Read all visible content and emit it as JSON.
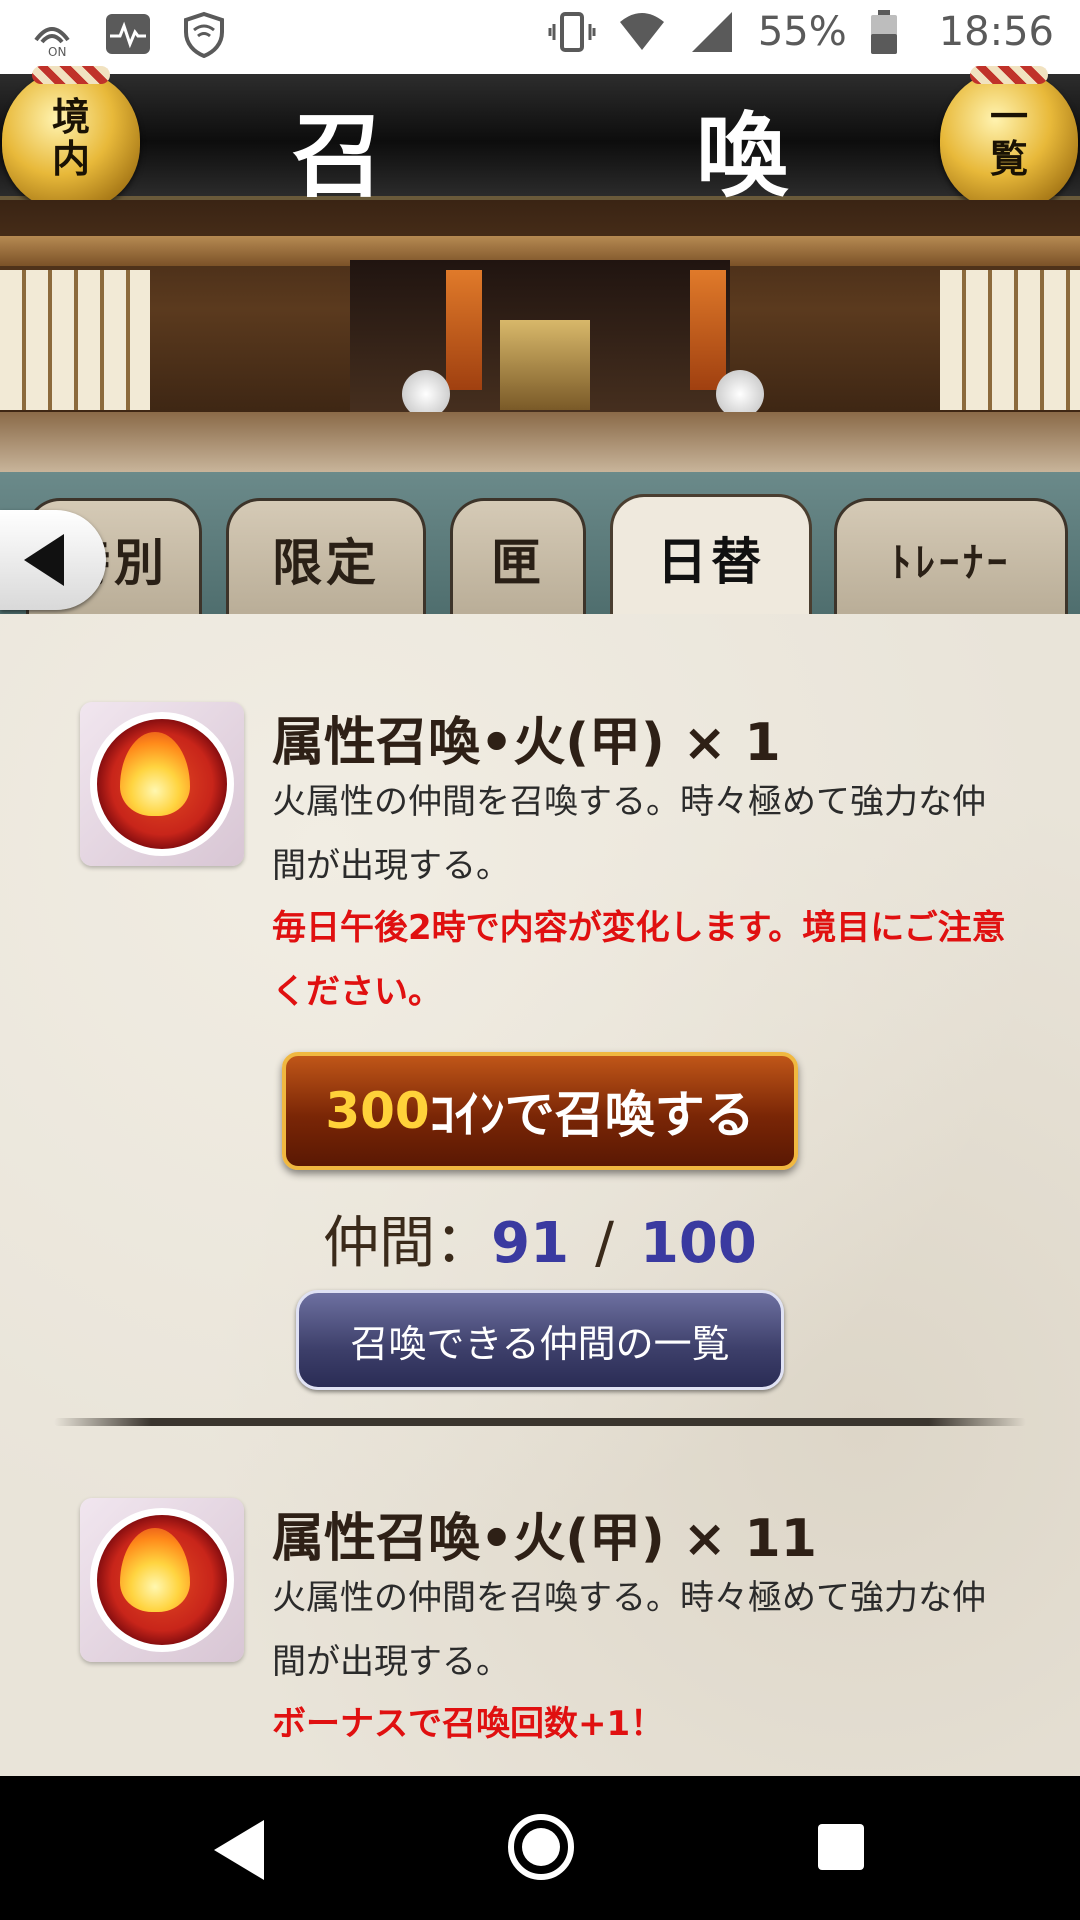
{
  "status_bar": {
    "battery": "55%",
    "time": "18:56",
    "left_icons": [
      "wifi-calling-icon",
      "activity-icon",
      "shield-icon"
    ],
    "right_icons": [
      "vibrate-icon",
      "wifi-icon",
      "signal-icon",
      "battery-icon"
    ]
  },
  "header": {
    "title": "召　喚",
    "left_bell_label": "境\n内",
    "right_bell_label": "一\n覧"
  },
  "tabs": [
    {
      "label": "特別",
      "active": false
    },
    {
      "label": "限定",
      "active": false
    },
    {
      "label": "匣",
      "active": false
    },
    {
      "label": "日替",
      "active": true
    },
    {
      "label": "ﾄﾚｰﾅｰ",
      "active": false
    }
  ],
  "cards": [
    {
      "title": "属性召喚•火(甲) × 1",
      "description": "火属性の仲間を召喚する。時々極めて強力な仲間が出現する。",
      "notice": "毎日午後2時で内容が変化します。境目にご注意ください。",
      "button_number": "300",
      "button_text": "ｺｲﾝで召喚する",
      "count_label": "仲間：",
      "count_current": "91",
      "count_separator": "/",
      "count_max": "100",
      "list_button": "召喚できる仲間の一覧"
    },
    {
      "title": "属性召喚•火(甲) × 11",
      "description": "火属性の仲間を召喚する。時々極めて強力な仲間が出現する。",
      "notice": "ボーナスで召喚回数+1！"
    }
  ],
  "colors": {
    "accent_red": "#e01010",
    "count_blue": "#3a3aa0",
    "summon_button": "#7a2606",
    "list_button": "#3d3f6a"
  }
}
